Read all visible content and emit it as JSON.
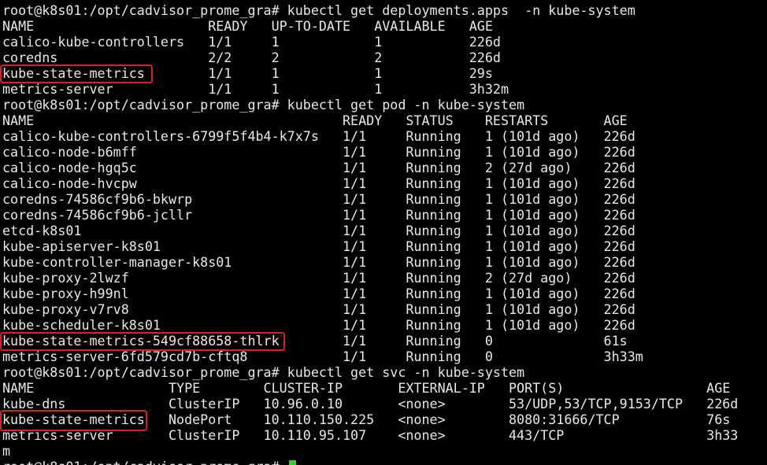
{
  "theme": {
    "background": "#000000",
    "foreground": "#e8e8e8",
    "highlight_color": "#e02020",
    "cursor_color": "#22dd22"
  },
  "lines": [
    "root@k8s01:/opt/cadvisor_prome_gra# kubectl get deployments.apps  -n kube-system",
    "NAME                      READY   UP-TO-DATE   AVAILABLE   AGE",
    "calico-kube-controllers   1/1     1            1           226d",
    "coredns                   2/2     2            2           226d",
    "kube-state-metrics        1/1     1            1           29s",
    "metrics-server            1/1     1            1           3h32m",
    "root@k8s01:/opt/cadvisor_prome_gra# kubectl get pod -n kube-system",
    "NAME                                       READY   STATUS    RESTARTS       AGE",
    "calico-kube-controllers-6799f5f4b4-k7x7s   1/1     Running   1 (101d ago)   226d",
    "calico-node-b6mff                          1/1     Running   1 (101d ago)   226d",
    "calico-node-hgq5c                          1/1     Running   2 (27d ago)    226d",
    "calico-node-hvcpw                          1/1     Running   1 (101d ago)   226d",
    "coredns-74586cf9b6-bkwrp                   1/1     Running   1 (101d ago)   226d",
    "coredns-74586cf9b6-jcllr                   1/1     Running   1 (101d ago)   226d",
    "etcd-k8s01                                 1/1     Running   1 (101d ago)   226d",
    "kube-apiserver-k8s01                       1/1     Running   1 (101d ago)   226d",
    "kube-controller-manager-k8s01              1/1     Running   1 (101d ago)   226d",
    "kube-proxy-2lwzf                           1/1     Running   2 (27d ago)    226d",
    "kube-proxy-h99nl                           1/1     Running   1 (101d ago)   226d",
    "kube-proxy-v7rv8                           1/1     Running   1 (101d ago)   226d",
    "kube-scheduler-k8s01                       1/1     Running   1 (101d ago)   226d",
    "kube-state-metrics-549cf88658-thlrk        1/1     Running   0              61s",
    "metrics-server-6fd579cd7b-cftq8            1/1     Running   0              3h33m",
    "root@k8s01:/opt/cadvisor_prome_gra# kubectl get svc -n kube-system",
    "NAME                 TYPE        CLUSTER-IP       EXTERNAL-IP   PORT(S)                  AGE",
    "kube-dns             ClusterIP   10.96.0.10       <none>        53/UDP,53/TCP,9153/TCP   226d",
    "kube-state-metrics   NodePort    10.110.150.225   <none>        8080:31666/TCP           76s",
    "metrics-server       ClusterIP   10.110.95.107    <none>        443/TCP                  3h33",
    "m",
    "root@k8s01:/opt/cadvisor_prome_gra# "
  ]
}
